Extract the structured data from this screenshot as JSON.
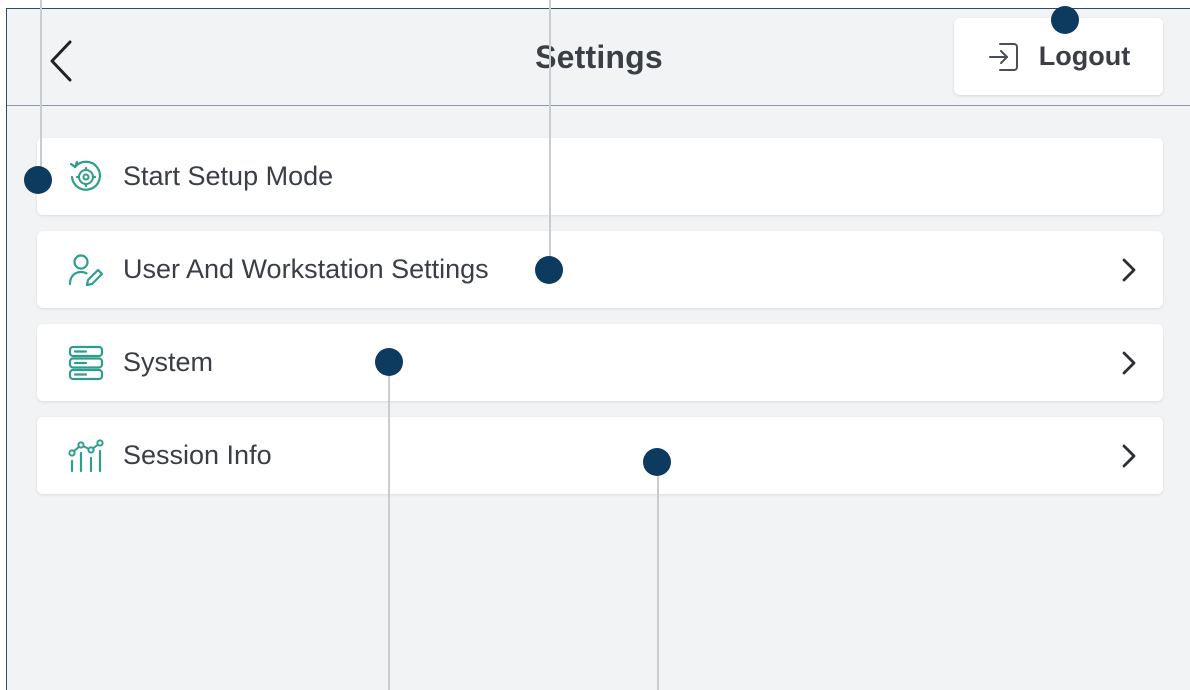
{
  "header": {
    "title": "Settings",
    "back_icon": "chevron-left-icon",
    "logout": {
      "label": "Logout",
      "icon": "logout-icon"
    }
  },
  "menu": {
    "items": [
      {
        "label": "Start Setup Mode",
        "icon": "setup-gear-icon",
        "has_chevron": false
      },
      {
        "label": "User And Workstation Settings",
        "icon": "user-edit-icon",
        "has_chevron": true
      },
      {
        "label": "System",
        "icon": "server-stack-icon",
        "has_chevron": true
      },
      {
        "label": "Session Info",
        "icon": "analytics-icon",
        "has_chevron": true
      }
    ]
  },
  "colors": {
    "background": "#f2f3f5",
    "card": "#ffffff",
    "text": "#3a3e45",
    "icon_accent": "#2e9e8c",
    "annotation_dot": "#0d3a5f",
    "annotation_line": "#c9ccd1"
  }
}
